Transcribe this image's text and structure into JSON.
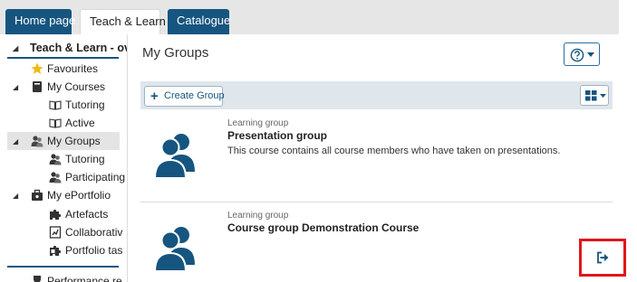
{
  "tabs": [
    {
      "label": "Home page"
    },
    {
      "label": "Teach & Learn"
    },
    {
      "label": "Catalogue"
    }
  ],
  "sidebar": {
    "title": "Teach & Learn - ov",
    "items": [
      {
        "label": "Favourites",
        "icon": "star-icon"
      },
      {
        "label": "My Courses",
        "icon": "book-icon"
      },
      {
        "label": "Tutoring",
        "icon": "open-book-icon"
      },
      {
        "label": "Active",
        "icon": "open-book-icon"
      },
      {
        "label": "My Groups",
        "icon": "group-icon"
      },
      {
        "label": "Tutoring",
        "icon": "group-icon"
      },
      {
        "label": "Participating",
        "icon": "group-icon"
      },
      {
        "label": "My ePortfolio",
        "icon": "briefcase-icon"
      },
      {
        "label": "Artefacts",
        "icon": "puzzle-icon"
      },
      {
        "label": "Collaborativ",
        "icon": "document-icon"
      },
      {
        "label": "Portfolio tas",
        "icon": "puzzle-icon"
      },
      {
        "label": "Performance re",
        "icon": "trophy-icon"
      }
    ]
  },
  "main": {
    "title": "My Groups",
    "create_label": "Create Group",
    "groups": [
      {
        "type": "Learning group",
        "title": "Presentation group",
        "description": "This course contains all course members who have taken on presentations."
      },
      {
        "type": "Learning group",
        "title": "Course group Demonstration Course"
      }
    ]
  },
  "colors": {
    "brand_blue": "#16557f",
    "highlight_red": "#e0161b",
    "star_yellow": "#f2b90f"
  }
}
